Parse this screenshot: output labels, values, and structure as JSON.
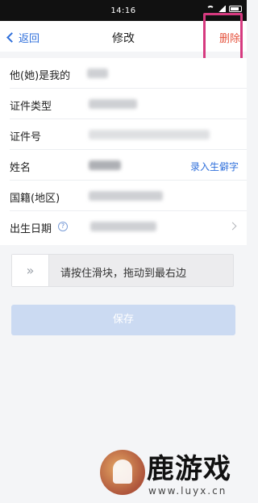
{
  "status_bar": {
    "time": "14:16"
  },
  "nav": {
    "back_label": "返回",
    "title": "修改",
    "delete_label": "删除"
  },
  "form": {
    "rows": [
      {
        "label": "他(她)是我的"
      },
      {
        "label": "证件类型"
      },
      {
        "label": "证件号"
      },
      {
        "label": "姓名",
        "action": "录入生僻字"
      },
      {
        "label": "国籍(地区)"
      },
      {
        "label": "出生日期",
        "help": "?"
      }
    ]
  },
  "slider": {
    "handle_icon": "double-chevron-right-icon",
    "handle_glyph": "»",
    "instruction": "请按住滑块，拖动到最右边"
  },
  "save_button": {
    "label": "保存"
  },
  "watermark": {
    "name": "鹿游戏",
    "url": "www.luyx.cn"
  },
  "colors": {
    "accent": "#2f6fdb",
    "delete": "#e5533d",
    "highlight": "#d63a7f",
    "save_disabled": "#cbdaf2"
  }
}
